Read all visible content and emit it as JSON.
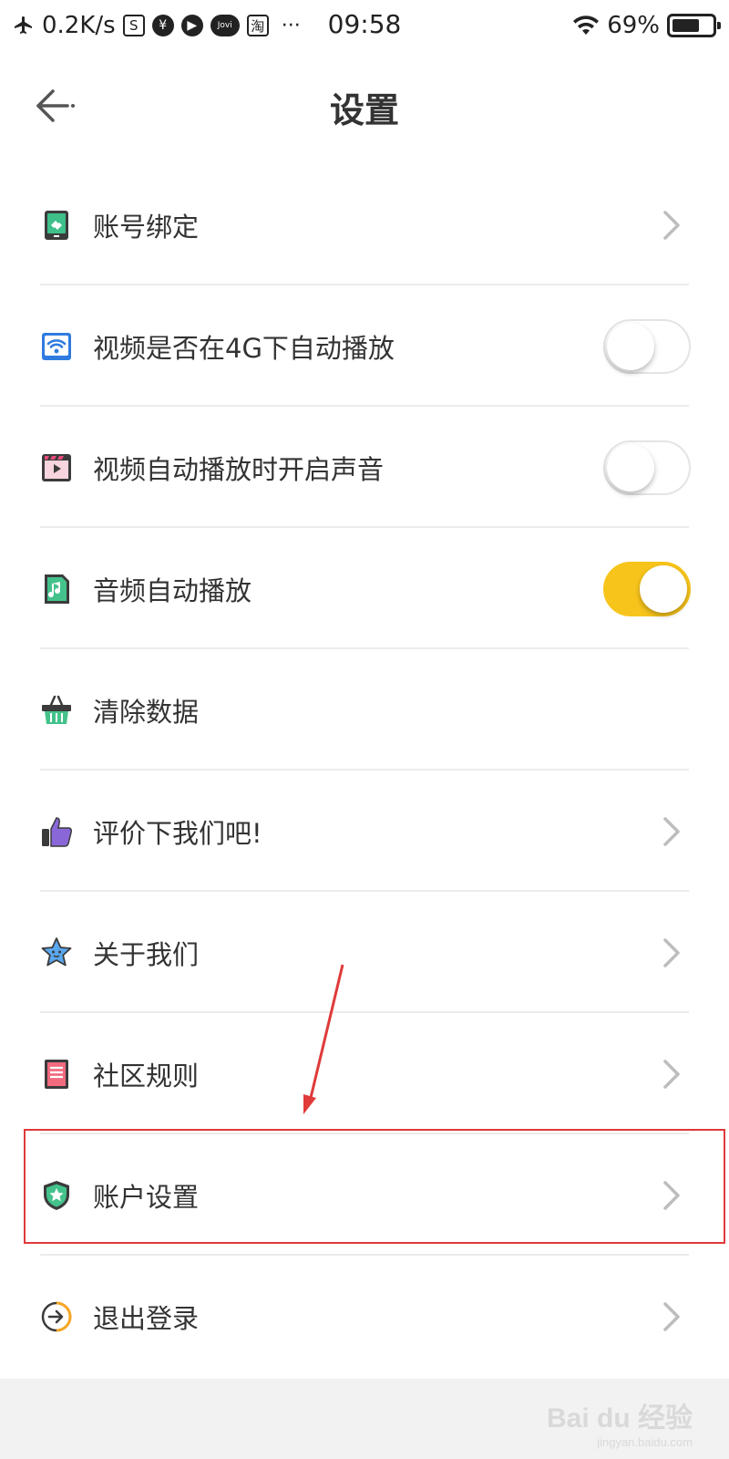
{
  "status_bar": {
    "net_speed": "0.2K/s",
    "time": "09:58",
    "battery": "69%",
    "battery_level": 0.69,
    "icons": [
      "airplane-icon",
      "s-app-icon",
      "yen-icon",
      "play-icon",
      "jovi-icon",
      "taobao-icon",
      "more-icon",
      "wifi-icon",
      "battery-icon"
    ],
    "notif_labels": [
      "S",
      "¥",
      "▶",
      "Jovi",
      "淘",
      "···"
    ]
  },
  "nav": {
    "title": "设置",
    "back_icon": "back-arrow-icon"
  },
  "settings": [
    {
      "label": "账号绑定",
      "icon": "account-bind-icon",
      "control": "chevron"
    },
    {
      "label": "视频是否在4G下自动播放",
      "icon": "wifi-video-icon",
      "control": "switch",
      "on": false
    },
    {
      "label": "视频自动播放时开启声音",
      "icon": "video-sound-icon",
      "control": "switch",
      "on": false
    },
    {
      "label": "音频自动播放",
      "icon": "audio-icon",
      "control": "switch",
      "on": true
    },
    {
      "label": "清除数据",
      "icon": "basket-icon",
      "control": "none"
    },
    {
      "label": "评价下我们吧!",
      "icon": "thumbs-up-icon",
      "control": "chevron"
    },
    {
      "label": "关于我们",
      "icon": "star-face-icon",
      "control": "chevron"
    },
    {
      "label": "社区规则",
      "icon": "rules-book-icon",
      "control": "chevron"
    },
    {
      "label": "账户设置",
      "icon": "shield-star-icon",
      "control": "chevron"
    },
    {
      "label": "退出登录",
      "icon": "logout-icon",
      "control": "chevron"
    }
  ],
  "annotation": {
    "highlighted_item": "账户设置",
    "color": "#e03a3a"
  },
  "colors": {
    "switch_on": "#f7c41b",
    "divider": "#ececec",
    "footer": "#f2f2f2"
  },
  "watermark": {
    "brand": "Bai du 经验",
    "url": "jingyan.baidu.com"
  }
}
